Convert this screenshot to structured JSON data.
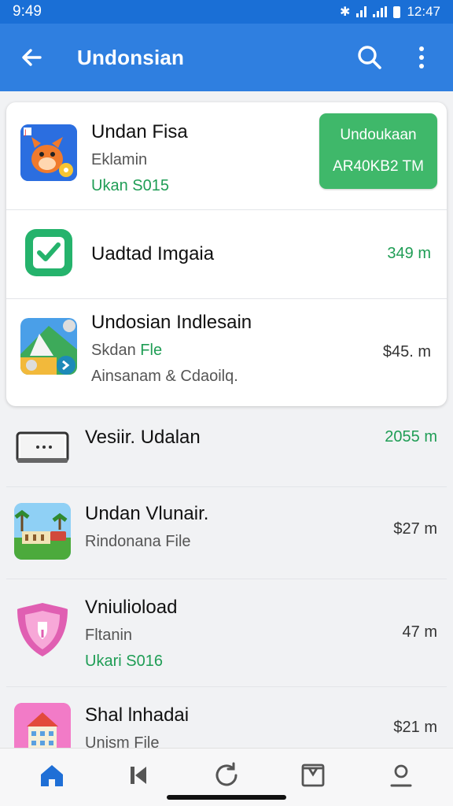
{
  "status_bar": {
    "time": "9:49",
    "right_time": "12:47"
  },
  "app_bar": {
    "title": "Undonsian",
    "icons": {
      "back": "arrow-left-icon",
      "search": "search-icon",
      "more": "more-vert-icon"
    }
  },
  "featured": {
    "title": "Undan Fisa",
    "subtitle": "Eklamin",
    "meta": "Ukan S015",
    "button_line1": "Undoukaan",
    "button_line2": "AR40KB2 TM"
  },
  "card_items": [
    {
      "title": "Uadtad Imgaia",
      "size": "349 m"
    },
    {
      "title": "Undosian Indlesain",
      "sub_a": "Skdan",
      "sub_b": "Fle",
      "sub2": "Ainsanam & Cdaoilq.",
      "size": "$45. m"
    }
  ],
  "list_items": [
    {
      "title": "Vesiir. Udalan",
      "size": "2055 m"
    },
    {
      "title": "Undan Vlunair.",
      "subtitle": "Rindonana File",
      "size": "$27 m"
    },
    {
      "title": "Vniulioload",
      "subtitle": "Fltanin",
      "meta": "Ukari S016",
      "size": "47 m"
    },
    {
      "title": "Shal lnhadai",
      "subtitle": "Unism File",
      "size": "$21 m"
    }
  ],
  "bottom_nav": [
    "home-icon",
    "media-icon",
    "refresh-icon",
    "files-icon",
    "profile-icon"
  ],
  "colors": {
    "primary": "#2f7fe0",
    "accent_green": "#3fb86a",
    "green_text": "#1f9d55"
  }
}
